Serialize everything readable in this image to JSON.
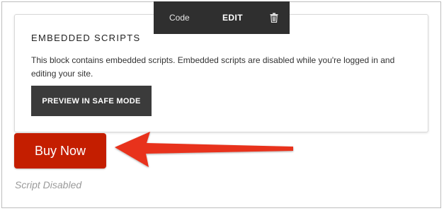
{
  "toolbar": {
    "code_label": "Code",
    "edit_label": "EDIT",
    "delete_icon": "trash-icon"
  },
  "block": {
    "title": "EMBEDDED SCRIPTS",
    "description": "This block contains embedded scripts. Embedded scripts are disabled while you're logged in and editing your site.",
    "preview_button_label": "PREVIEW IN SAFE MODE"
  },
  "buy_button": {
    "label": "Buy Now"
  },
  "status_text": "Script Disabled",
  "annotation": {
    "arrow_icon": "left-arrow-icon"
  },
  "colors": {
    "toolbar_bg": "#2f2f2f",
    "preview_button_bg": "#3b3b3b",
    "buy_button_bg": "#c41e00",
    "arrow_red": "#e8321c",
    "status_text": "#9a9a9a"
  }
}
